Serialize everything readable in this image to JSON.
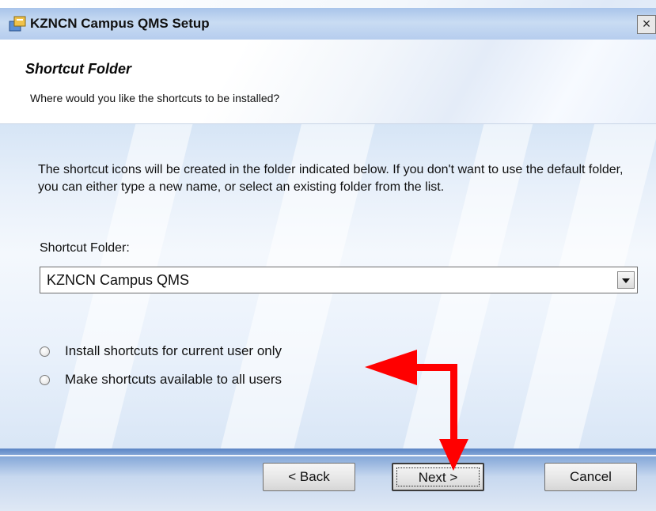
{
  "window": {
    "title": "KZNCN Campus QMS Setup",
    "close_glyph": "×",
    "app_icon": "installer-icon"
  },
  "header": {
    "title": "Shortcut Folder",
    "subtitle": "Where would you like the shortcuts to be installed?"
  },
  "body": {
    "intro": "The shortcut icons will be created in the folder indicated below. If you don't want to use the default folder, you can either type a new name, or select an existing folder from the list.",
    "folder_label": "Shortcut Folder:",
    "folder_value": "KZNCN Campus QMS",
    "radio_options": [
      {
        "label": "Install shortcuts for current user only",
        "selected": false
      },
      {
        "label": "Make shortcuts available to all users",
        "selected": false
      }
    ]
  },
  "buttons": {
    "back": "< Back",
    "next": "Next >",
    "cancel": "Cancel"
  },
  "annotation": {
    "color": "#ff0000",
    "description_icon": "red-arrow-annotation"
  }
}
